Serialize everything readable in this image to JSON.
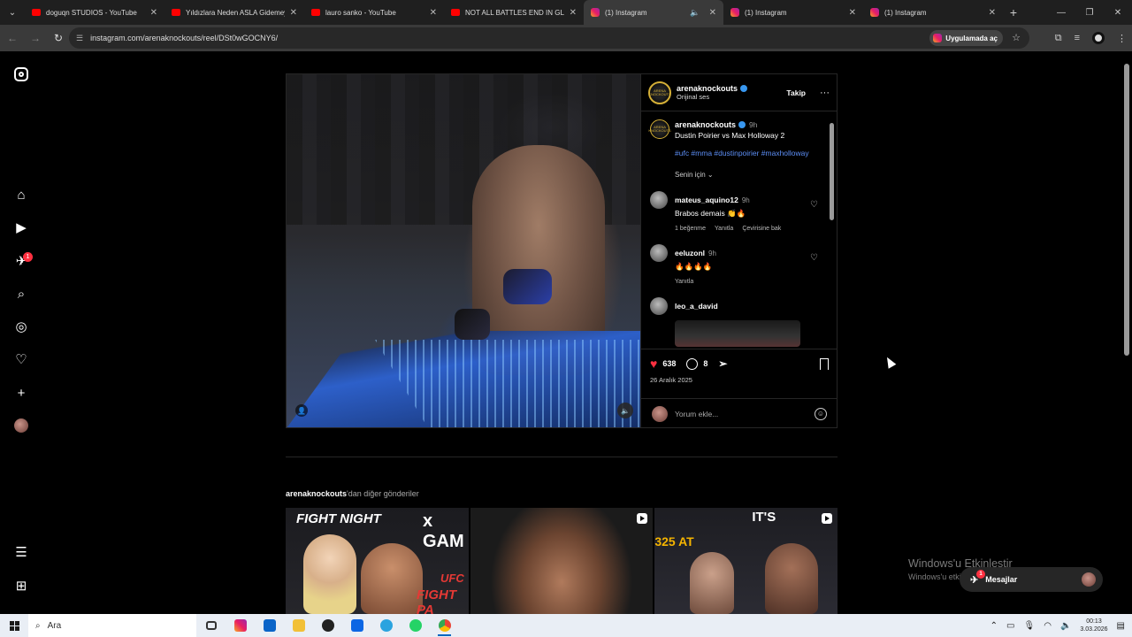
{
  "browser": {
    "tabs": [
      {
        "title": "doguqn STUDIOS - YouTube",
        "favicon": "youtube-icon"
      },
      {
        "title": "Yıldızlara Neden ASLA Gidemey",
        "favicon": "youtube-icon"
      },
      {
        "title": "lauro sanko - YouTube",
        "favicon": "youtube-icon"
      },
      {
        "title": "NOT ALL BATTLES END IN GLO",
        "favicon": "youtube-icon"
      },
      {
        "title": "(1) Instagram",
        "favicon": "instagram-icon",
        "active": true
      },
      {
        "title": "(1) Instagram",
        "favicon": "instagram-icon"
      },
      {
        "title": "(1) Instagram",
        "favicon": "instagram-icon"
      }
    ],
    "url": "instagram.com/arenaknockouts/reel/DSt0wGOCNY6/",
    "open_in_app_label": "Uygulamada aç"
  },
  "sidebar": {
    "notification_count": "1"
  },
  "post": {
    "username": "arenaknockouts",
    "audio": "Orijinal ses",
    "follow_label": "Takip",
    "avatar_text": "ARENA KNOCKOUTS",
    "caption_time": "9h",
    "caption": "Dustin Poirier vs Max Holloway 2",
    "hashtags": "#ufc #mma #dustinpoirier #maxholloway",
    "sort_label": "Senin için",
    "likes": "638",
    "comments_count": "8",
    "date": "26 Aralık 2025",
    "comment_placeholder": "Yorum ekle..."
  },
  "comments": [
    {
      "user": "mateus_aquino12",
      "time": "9h",
      "text": "Brabos demais 👏🔥",
      "likes": "1 beğenme",
      "reply": "Yanıtla",
      "translate": "Çevirisine bak"
    },
    {
      "user": "eeluzonl",
      "time": "9h",
      "text": "🔥🔥🔥🔥",
      "reply": "Yanıtla"
    },
    {
      "user": "leo_a_david"
    }
  ],
  "more_posts": {
    "title_user": "arenaknockouts",
    "title_suffix": "'dan diğer gönderiler",
    "thumb1": {
      "t1": "FIGHT NIGHT",
      "t2": "x GAM",
      "t3": "UFC",
      "t4": "FIGHT PA"
    },
    "thumb3": {
      "t5": "IT'S",
      "t6": "325 AT"
    }
  },
  "windows": {
    "activate_title": "Windows'u Etkinleştir",
    "activate_sub": "Windows'u etkinleştirmek için Ayarlar'a gidin",
    "messages_label": "Mesajlar",
    "messages_badge": "1",
    "search_label": "Ara",
    "time": "00:13",
    "date": "3.03.2026"
  },
  "colors": {
    "accent_like": "#ff3040",
    "link": "#5d8ff7",
    "verified": "#3897f0"
  }
}
